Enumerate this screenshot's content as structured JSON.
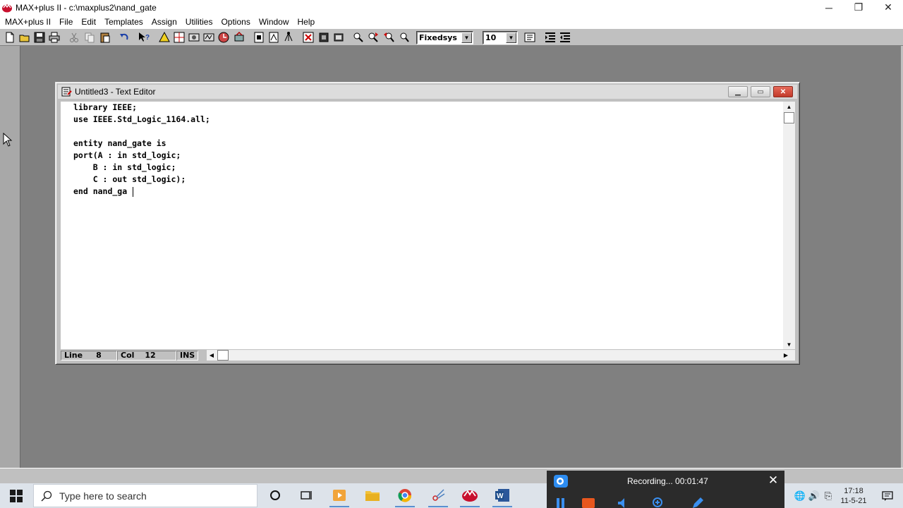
{
  "app": {
    "title": "MAX+plus II - c:\\maxplus2\\nand_gate",
    "window_buttons": {
      "minimize": "─",
      "restore": "❐",
      "close": "✕"
    }
  },
  "menu": [
    "MAX+plus II",
    "File",
    "Edit",
    "Templates",
    "Assign",
    "Utilities",
    "Options",
    "Window",
    "Help"
  ],
  "toolbar": {
    "font_value": "Fixedsys",
    "size_value": "10"
  },
  "editor": {
    "title": "Untitled3 - Text Editor",
    "lines": [
      "library IEEE;",
      "use IEEE.Std_Logic_1164.all;",
      "",
      "entity nand_gate is",
      "port(A : in std_logic;",
      "    B : in std_logic;",
      "    C : out std_logic);",
      "end nand_ga"
    ],
    "status": {
      "line_label": "Line",
      "line_value": "8",
      "col_label": "Col",
      "col_value": "12",
      "mode": "INS"
    }
  },
  "taskbar": {
    "search_placeholder": "Type here to search",
    "clock_time": "17:18",
    "clock_date": "11-5-21"
  },
  "recording": {
    "text": "Recording... 00:01:47"
  },
  "colors": {
    "mdi_background": "#808080",
    "toolbar_gray": "#c0c0c0",
    "recording_bg": "#2b2b2b",
    "stop_orange": "#e8571e"
  }
}
